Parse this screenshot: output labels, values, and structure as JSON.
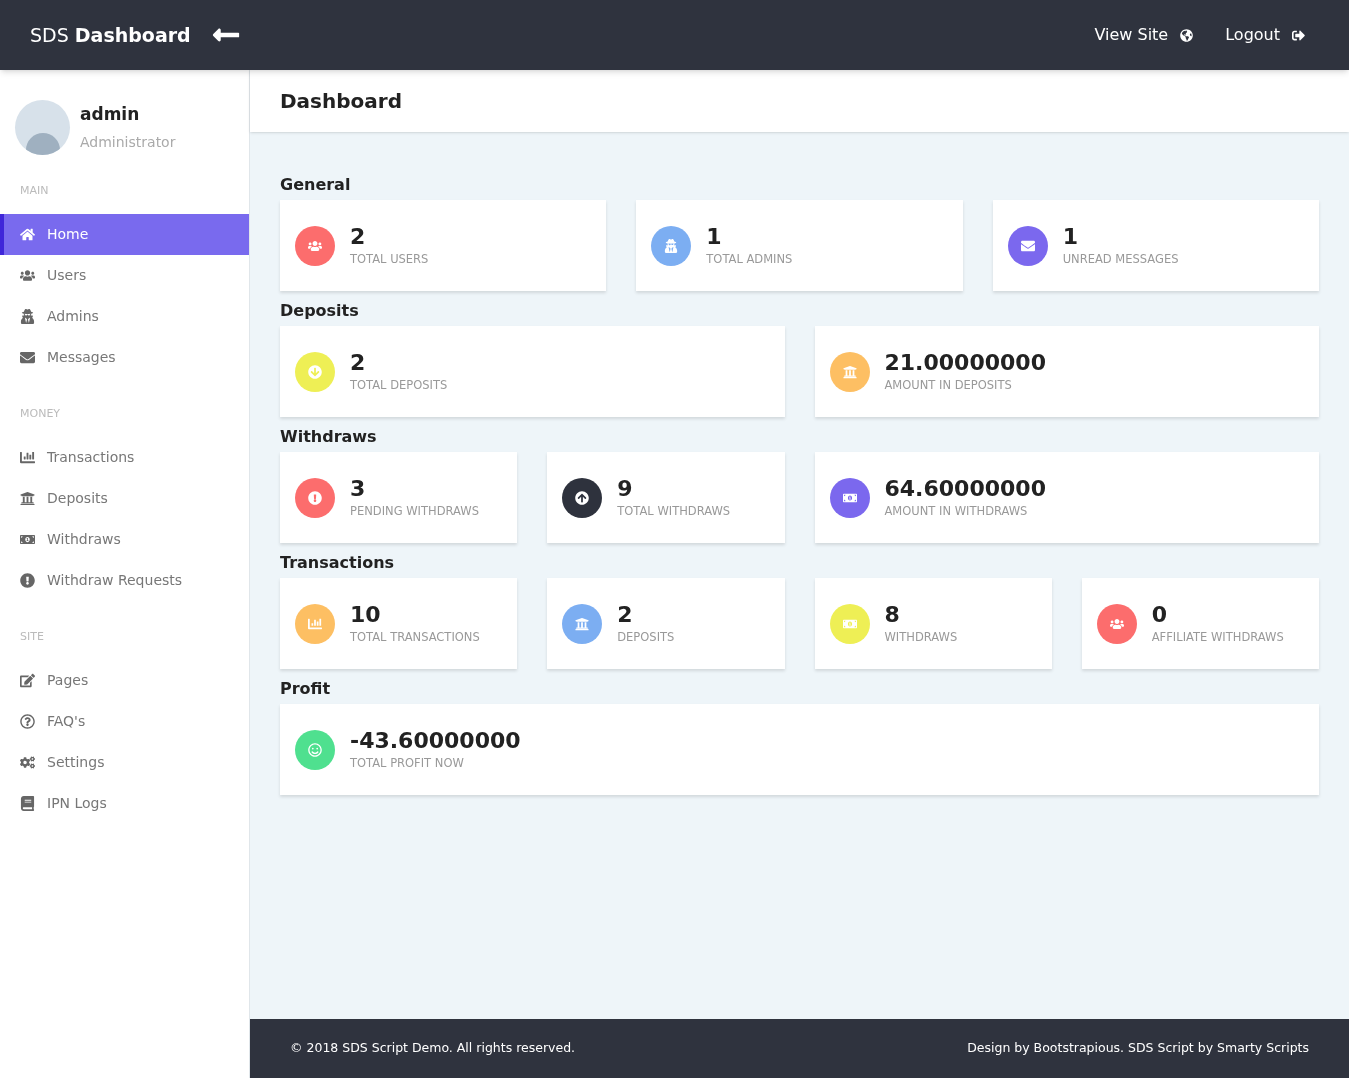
{
  "header": {
    "brand_light": "SDS",
    "brand_bold": "Dashboard",
    "links": [
      {
        "label": "View Site"
      },
      {
        "label": "Logout"
      }
    ]
  },
  "profile": {
    "name": "admin",
    "role": "Administrator"
  },
  "sidebar": {
    "sections": [
      {
        "label": "MAIN",
        "items": [
          {
            "label": "Home",
            "selected": true
          },
          {
            "label": "Users",
            "selected": false
          },
          {
            "label": "Admins",
            "selected": false
          },
          {
            "label": "Messages",
            "selected": false
          }
        ]
      },
      {
        "label": "MONEY",
        "items": [
          {
            "label": "Transactions",
            "selected": false
          },
          {
            "label": "Deposits",
            "selected": false
          },
          {
            "label": "Withdraws",
            "selected": false
          },
          {
            "label": "Withdraw Requests",
            "selected": false
          }
        ]
      },
      {
        "label": "SITE",
        "items": [
          {
            "label": "Pages",
            "selected": false
          },
          {
            "label": "FAQ's",
            "selected": false
          },
          {
            "label": "Settings",
            "selected": false
          },
          {
            "label": "IPN Logs",
            "selected": false
          }
        ]
      }
    ]
  },
  "page_title": "Dashboard",
  "groups": [
    {
      "title": "General",
      "cards": [
        {
          "value": "2",
          "label": "TOTAL USERS",
          "color": "#fc6d6d"
        },
        {
          "value": "1",
          "label": "TOTAL ADMINS",
          "color": "#7caef2"
        },
        {
          "value": "1",
          "label": "UNREAD MESSAGES",
          "color": "#7b68ee"
        }
      ]
    },
    {
      "title": "Deposits",
      "cards": [
        {
          "value": "2",
          "label": "TOTAL DEPOSITS",
          "color": "#eeef55"
        },
        {
          "value": "21.00000000",
          "label": "AMOUNT IN DEPOSITS",
          "color": "#fdbf63"
        }
      ]
    },
    {
      "title": "Withdraws",
      "cards": [
        {
          "value": "3",
          "label": "PENDING WITHDRAWS",
          "color": "#fc6d6d"
        },
        {
          "value": "9",
          "label": "TOTAL WITHDRAWS",
          "color": "#2e323d"
        },
        {
          "value": "64.60000000",
          "label": "AMOUNT IN WITHDRAWS",
          "color": "#7b68ee"
        }
      ]
    },
    {
      "title": "Transactions",
      "cards": [
        {
          "value": "10",
          "label": "TOTAL TRANSACTIONS",
          "color": "#fdbf63"
        },
        {
          "value": "2",
          "label": "DEPOSITS",
          "color": "#7caef2"
        },
        {
          "value": "8",
          "label": "WITHDRAWS",
          "color": "#eeef55"
        },
        {
          "value": "0",
          "label": "AFFILIATE WITHDRAWS",
          "color": "#fc6d6d"
        }
      ]
    },
    {
      "title": "Profit",
      "cards": [
        {
          "value": "-43.60000000",
          "label": "TOTAL PROFIT NOW",
          "color": "#4fe08f"
        }
      ]
    }
  ],
  "footer": {
    "left": "© 2018 SDS Script Demo. All rights reserved.",
    "right": "Design by Bootstrapious. SDS Script by Smarty Scripts"
  }
}
